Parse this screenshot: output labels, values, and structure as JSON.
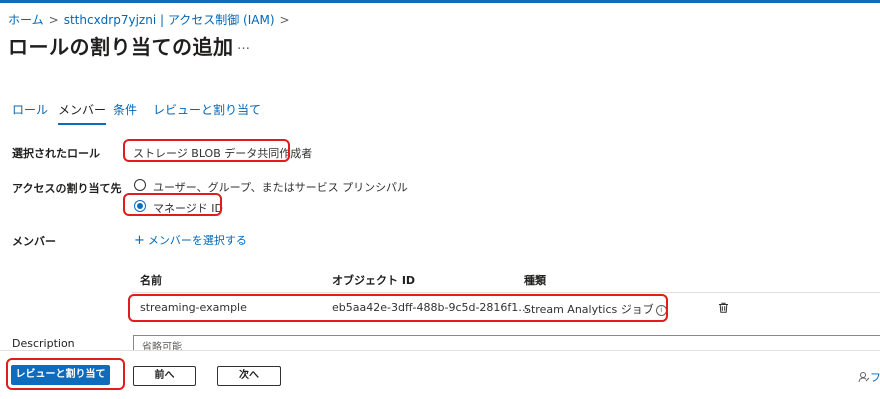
{
  "breadcrumb": {
    "items": [
      "ホーム",
      "stthcxdrp7yjzni | アクセス制御 (IAM)"
    ],
    "separator": ">"
  },
  "page": {
    "title": "ロールの割り当ての追加",
    "more": "…"
  },
  "tabs": [
    "ロール",
    "メンバー",
    "条件",
    "レビューと割り当て"
  ],
  "active_tab": "メンバー",
  "form": {
    "selected_role_label": "選択されたロール",
    "selected_role_value": "ストレージ BLOB データ共同作成者",
    "assign_access_label": "アクセスの割り当て先",
    "assign_options": [
      "ユーザー、グループ、またはサービス プリンシパル",
      "マネージド ID"
    ],
    "assign_selected": "マネージド ID",
    "members_label": "メンバー",
    "select_members_link": "メンバーを選択する",
    "description_label": "Description",
    "description_placeholder": "省略可能"
  },
  "table": {
    "columns": [
      "名前",
      "オブジェクト ID",
      "種類"
    ],
    "rows": [
      {
        "name": "streaming-example",
        "object_id": "eb5aa42e-3dff-488b-9c5d-2816f1…",
        "type": "Stream Analytics ジョブ",
        "info": "i"
      }
    ]
  },
  "footer": {
    "review_assign": "レビューと割り当て",
    "previous": "前へ",
    "next": "次へ",
    "feedback_partial": "フ"
  },
  "colors": {
    "accent": "#0f6cbd",
    "link": "#0067b8",
    "highlight": "#e11c1c"
  }
}
